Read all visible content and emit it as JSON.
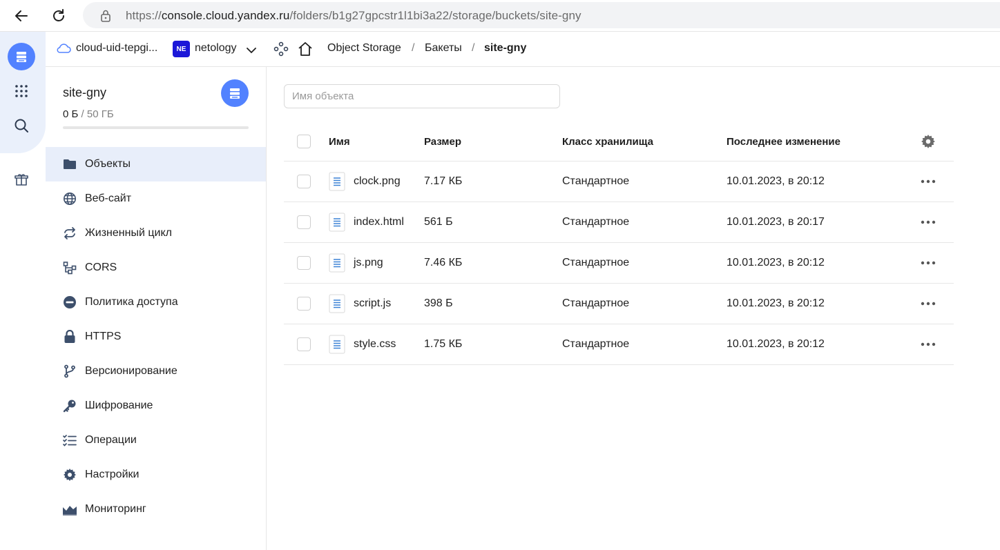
{
  "browser": {
    "url_scheme": "https://",
    "url_host": "console.cloud.yandex.ru",
    "url_path": "/folders/b1g27gpcstr1l1bi3a22/storage/buckets/site-gny"
  },
  "header": {
    "cloud_name": "cloud-uid-tepgi...",
    "org_badge": "NE",
    "org_name": "netology",
    "breadcrumbs": [
      "Object Storage",
      "Бакеты",
      "site-gny"
    ],
    "separator": "/"
  },
  "bucket": {
    "name": "site-gny",
    "used": "0 Б",
    "divider": " / ",
    "quota": "50 ГБ",
    "usage_fraction": 0
  },
  "menu": [
    {
      "label": "Объекты",
      "icon": "folder-icon",
      "active": true
    },
    {
      "label": "Веб-сайт",
      "icon": "globe-icon",
      "active": false
    },
    {
      "label": "Жизненный цикл",
      "icon": "cycle-icon",
      "active": false
    },
    {
      "label": "CORS",
      "icon": "cors-icon",
      "active": false
    },
    {
      "label": "Политика доступа",
      "icon": "no-entry-icon",
      "active": false
    },
    {
      "label": "HTTPS",
      "icon": "lock-icon",
      "active": false
    },
    {
      "label": "Версионирование",
      "icon": "branch-icon",
      "active": false
    },
    {
      "label": "Шифрование",
      "icon": "key-icon",
      "active": false
    },
    {
      "label": "Операции",
      "icon": "list-check-icon",
      "active": false
    },
    {
      "label": "Настройки",
      "icon": "gear-icon",
      "active": false
    },
    {
      "label": "Мониторинг",
      "icon": "chart-icon",
      "active": false
    }
  ],
  "search": {
    "placeholder": "Имя объекта",
    "value": ""
  },
  "table": {
    "columns": {
      "name": "Имя",
      "size": "Размер",
      "class": "Класс хранилища",
      "modified": "Последнее изменение"
    },
    "rows": [
      {
        "name": "clock.png",
        "size": "7.17 КБ",
        "class": "Стандартное",
        "modified": "10.01.2023, в 20:12"
      },
      {
        "name": "index.html",
        "size": "561 Б",
        "class": "Стандартное",
        "modified": "10.01.2023, в 20:17"
      },
      {
        "name": "js.png",
        "size": "7.46 КБ",
        "class": "Стандартное",
        "modified": "10.01.2023, в 20:12"
      },
      {
        "name": "script.js",
        "size": "398 Б",
        "class": "Стандартное",
        "modified": "10.01.2023, в 20:12"
      },
      {
        "name": "style.css",
        "size": "1.75 КБ",
        "class": "Стандартное",
        "modified": "10.01.2023, в 20:12"
      }
    ]
  },
  "colors": {
    "accent": "#5282ff",
    "active_bg": "#e8eefa",
    "icon": "#3d4f6b",
    "org_badge": "#1c18d8"
  }
}
